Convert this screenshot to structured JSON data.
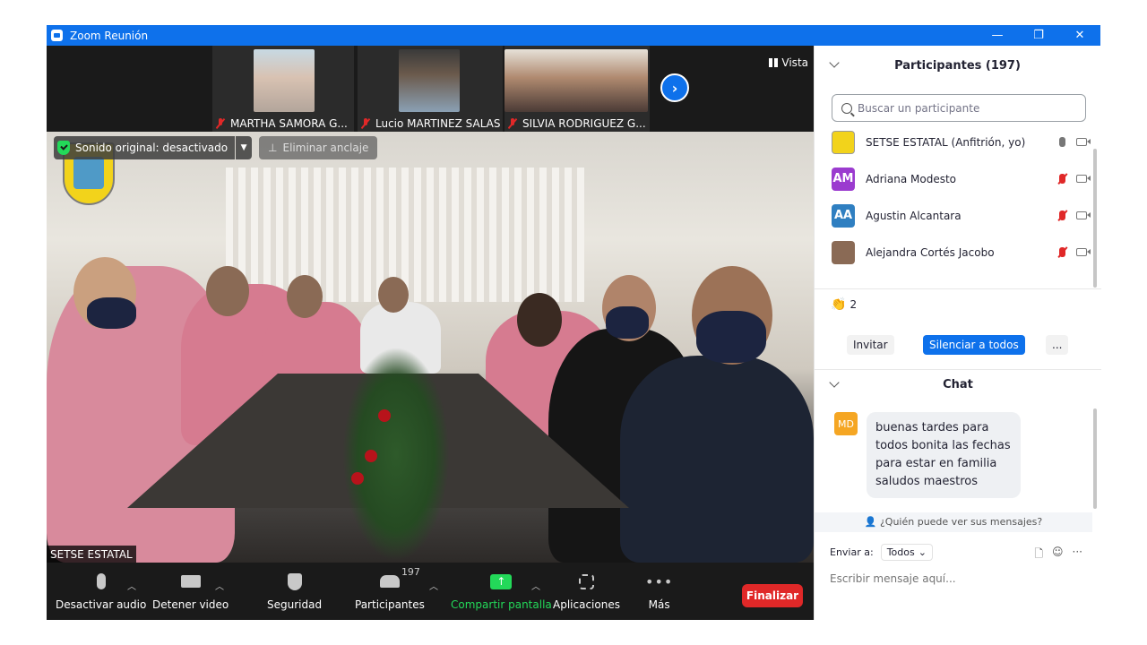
{
  "window": {
    "title": "Zoom Reunión",
    "controls": [
      "—",
      "❐",
      "✕"
    ]
  },
  "thumbnails": [
    {
      "name": "MARTHA SAMORA G...",
      "muted": true
    },
    {
      "name": "Lucio MARTINEZ SALAS",
      "muted": true
    },
    {
      "name": "SILVIA RODRIGUEZ G...",
      "muted": true
    }
  ],
  "view_label": "Vista",
  "sound_original": "Sonido original: desactivado",
  "unpin_label": "Eliminar anclaje",
  "speaker_name": "SETSE ESTATAL",
  "toolbar": {
    "audio": "Desactivar audio",
    "video": "Detener video",
    "security": "Seguridad",
    "participants": "Participantes",
    "participant_count": "197",
    "share": "Compartir pantalla",
    "apps": "Aplicaciones",
    "more": "Más",
    "end": "Finalizar"
  },
  "panel": {
    "participants_title": "Participantes (197)",
    "search_placeholder": "Buscar un participante",
    "participants": [
      {
        "name": "SETSE ESTATAL (Anfitrión, yo)",
        "initials": "",
        "color": "#f2d31b",
        "muted": false
      },
      {
        "name": "Adriana Modesto",
        "initials": "AM",
        "color": "#9b3bcf",
        "muted": true
      },
      {
        "name": "Agustin Alcantara",
        "initials": "AA",
        "color": "#2f7fc1",
        "muted": true
      },
      {
        "name": "Alejandra Cortés Jacobo",
        "initials": "",
        "color": "#8a6a55",
        "muted": true
      }
    ],
    "reaction_count": "2",
    "invite": "Invitar",
    "mute_all": "Silenciar a todos",
    "more": "...",
    "chat_title": "Chat",
    "chat_message": {
      "initials": "MD",
      "text": "buenas tardes para todos bonita las fechas para estar en familia saludos maestros"
    },
    "who_sees": "¿Quién puede ver sus mensajes?",
    "send_to_label": "Enviar a:",
    "send_to_value": "Todos",
    "input_placeholder": "Escribir mensaje aquí..."
  },
  "colors": {
    "zoom_blue": "#0e71eb",
    "end_red": "#e02828",
    "share_green": "#23d959"
  }
}
